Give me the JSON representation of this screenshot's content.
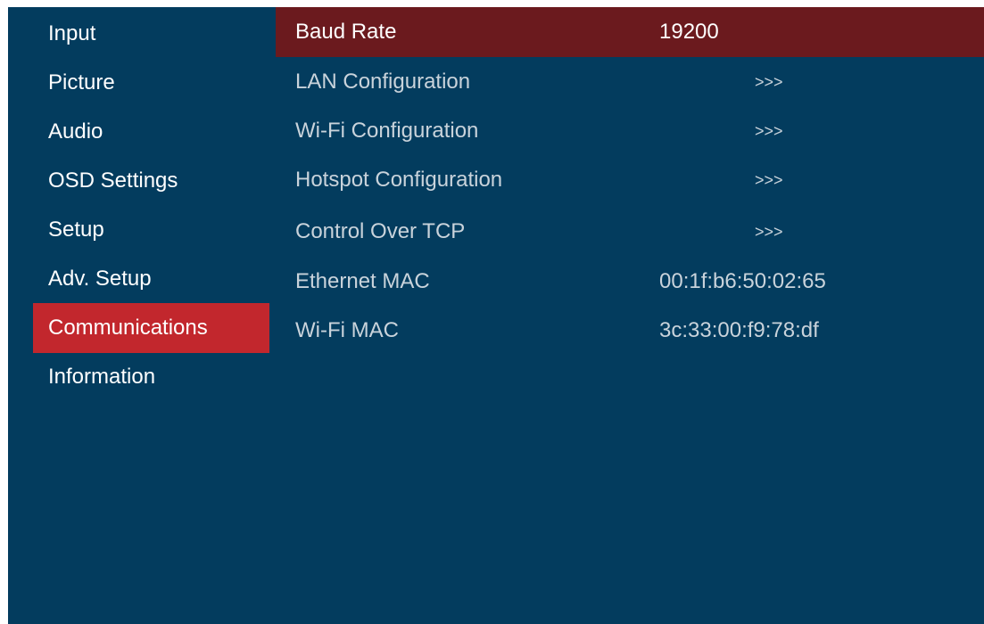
{
  "sidebar": {
    "items": [
      {
        "label": "Input"
      },
      {
        "label": "Picture"
      },
      {
        "label": "Audio"
      },
      {
        "label": "OSD Settings"
      },
      {
        "label": "Setup"
      },
      {
        "label": "Adv. Setup"
      },
      {
        "label": "Communications",
        "selected": true
      },
      {
        "label": "Information"
      }
    ]
  },
  "main": {
    "rows": [
      {
        "label": "Baud Rate",
        "value": "19200",
        "selected": true
      },
      {
        "label": "LAN Configuration",
        "value": ">>>"
      },
      {
        "label": "Wi-Fi Configuration",
        "value": ">>>"
      },
      {
        "label": "Hotspot Configuration",
        "value": ">>>"
      },
      {
        "label": "Control Over TCP",
        "value": ">>>"
      },
      {
        "label": "Ethernet MAC",
        "value": "00:1f:b6:50:02:65"
      },
      {
        "label": "Wi-Fi MAC",
        "value": "3c:33:00:f9:78:df"
      }
    ]
  },
  "colors": {
    "panel_background": "#033c5e",
    "sidebar_selected": "#c2272d",
    "row_selected": "#6b1a1e",
    "text_primary": "#ffffff",
    "text_secondary": "#c9d3db"
  }
}
